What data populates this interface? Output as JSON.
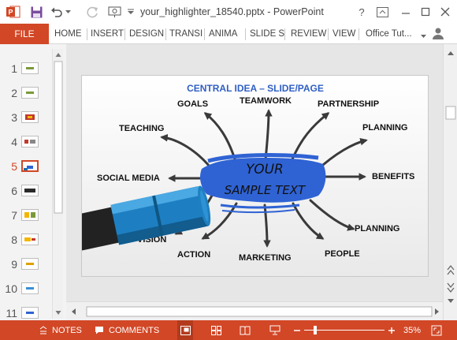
{
  "titlebar": {
    "document_title": "your_highlighter_18540.pptx - PowerPoint",
    "help_icon": "?",
    "colors": {
      "accent": "#d24726",
      "arrow": "#444444",
      "highlight": "#2f63d4",
      "slide_title": "#2f5fc4"
    }
  },
  "ribbon": {
    "file_label": "FILE",
    "tabs": [
      "HOME",
      "INSERT",
      "DESIGN",
      "TRANSI",
      "ANIMA",
      "SLIDE S",
      "REVIEW",
      "VIEW"
    ],
    "account": "Office Tut..."
  },
  "thumbnails": [
    {
      "num": "1",
      "color": "#7a9a3a"
    },
    {
      "num": "2",
      "color": "#7a9a3a"
    },
    {
      "num": "3",
      "color": "#c0392b"
    },
    {
      "num": "4",
      "color": "#c0392b"
    },
    {
      "num": "5",
      "color": "#2f63d4"
    },
    {
      "num": "6",
      "color": "#2a2a2a"
    },
    {
      "num": "7",
      "color": "#f2b705"
    },
    {
      "num": "8",
      "color": "#f2b705"
    },
    {
      "num": "9",
      "color": "#e0a000"
    },
    {
      "num": "10",
      "color": "#3a8fd4"
    },
    {
      "num": "11",
      "color": "#2f63d4"
    }
  ],
  "slide": {
    "title": "CENTRAL IDEA – SLIDE/PAGE",
    "center_line1": "YOUR",
    "center_line2": "SAMPLE TEXT",
    "labels": {
      "goals": "GOALS",
      "teamwork": "TEAMWORK",
      "partnership": "PARTNERSHIP",
      "teaching": "TEACHING",
      "planning_top": "PLANNING",
      "social_media": "SOCIAL MEDIA",
      "benefits": "BENEFITS",
      "vision": "VISION",
      "planning_bottom": "PLANNING",
      "action": "ACTION",
      "marketing": "MARKETING",
      "people": "PEOPLE"
    }
  },
  "statusbar": {
    "notes": "NOTES",
    "comments": "COMMENTS",
    "zoom": "35%"
  }
}
